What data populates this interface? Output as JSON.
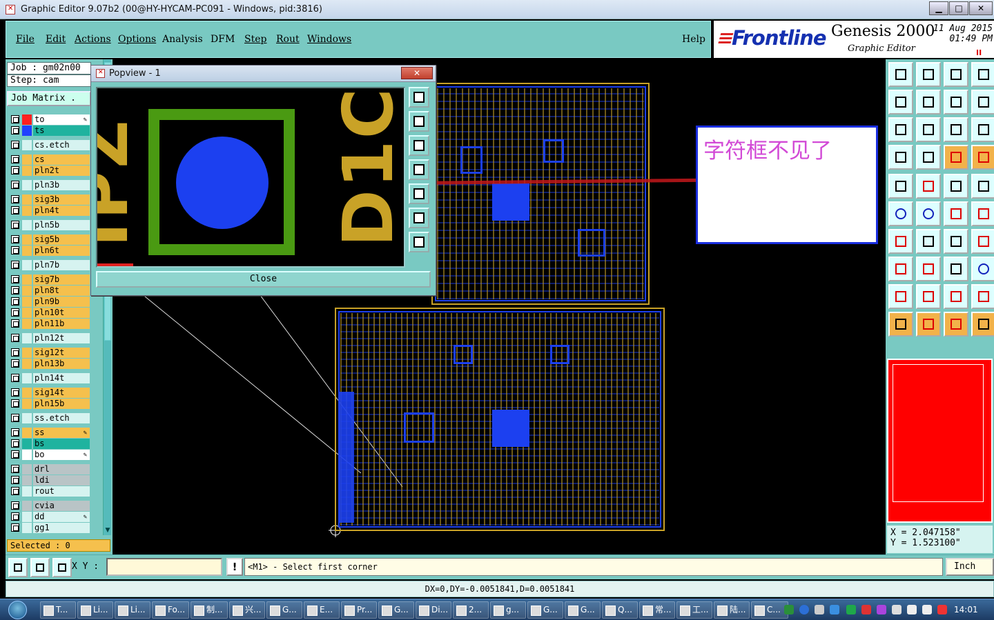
{
  "window": {
    "title": "Graphic Editor 9.07b2 (00@HY-HYCAM-PC091 - Windows, pid:3816)",
    "controls": [
      "▁",
      "□",
      "✕"
    ]
  },
  "menu": {
    "items": [
      "File",
      "Edit",
      "Actions",
      "Options",
      "Analysis",
      "DFM",
      "Step",
      "Rout",
      "Windows"
    ],
    "help": "Help"
  },
  "logo": {
    "brand": "Frontline",
    "product": "Genesis 2000",
    "subtitle": "Graphic Editor",
    "date": "11 Aug 2015",
    "time": "01:49 PM",
    "indicator": "II"
  },
  "job": {
    "job_line": "Job : gm02n00",
    "step_line": "Step: cam",
    "matrix_label": "Job Matrix ."
  },
  "layers": [
    {
      "name": "to",
      "color": "#ffffff",
      "swatch": "#ff2020",
      "pen": true
    },
    {
      "name": "ts",
      "color": "#1fb39f",
      "swatch": "#2040ff",
      "pen": false
    },
    {
      "name": "cs.etch",
      "color": "#d6f3f0",
      "swatch": "",
      "pen": false
    },
    {
      "name": "cs",
      "color": "#f5c04d",
      "swatch": "",
      "pen": false
    },
    {
      "name": "pln2t",
      "color": "#f5c04d",
      "swatch": "",
      "pen": false
    },
    {
      "name": "pln3b",
      "color": "#d6f3f0",
      "swatch": "",
      "pen": false
    },
    {
      "name": "sig3b",
      "color": "#f5c04d",
      "swatch": "",
      "pen": false
    },
    {
      "name": "pln4t",
      "color": "#f5c04d",
      "swatch": "",
      "pen": false
    },
    {
      "name": "pln5b",
      "color": "#d6f3f0",
      "swatch": "",
      "pen": false
    },
    {
      "name": "sig5b",
      "color": "#f5c04d",
      "swatch": "",
      "pen": false
    },
    {
      "name": "pln6t",
      "color": "#f5c04d",
      "swatch": "",
      "pen": false
    },
    {
      "name": "pln7b",
      "color": "#d6f3f0",
      "swatch": "",
      "pen": false
    },
    {
      "name": "sig7b",
      "color": "#f5c04d",
      "swatch": "",
      "pen": false
    },
    {
      "name": "pln8t",
      "color": "#f5c04d",
      "swatch": "",
      "pen": false
    },
    {
      "name": "pln9b",
      "color": "#f5c04d",
      "swatch": "",
      "pen": false
    },
    {
      "name": "pln10t",
      "color": "#f5c04d",
      "swatch": "",
      "pen": false
    },
    {
      "name": "pln11b",
      "color": "#f5c04d",
      "swatch": "",
      "pen": false
    },
    {
      "name": "pln12t",
      "color": "#d6f3f0",
      "swatch": "",
      "pen": false
    },
    {
      "name": "sig12t",
      "color": "#f5c04d",
      "swatch": "",
      "pen": false
    },
    {
      "name": "pln13b",
      "color": "#f5c04d",
      "swatch": "",
      "pen": false
    },
    {
      "name": "pln14t",
      "color": "#d6f3f0",
      "swatch": "",
      "pen": false
    },
    {
      "name": "sig14t",
      "color": "#f5c04d",
      "swatch": "",
      "pen": false
    },
    {
      "name": "pln15b",
      "color": "#f5c04d",
      "swatch": "",
      "pen": false
    },
    {
      "name": "ss.etch",
      "color": "#d6f3f0",
      "swatch": "",
      "pen": false
    },
    {
      "name": "ss",
      "color": "#f5c04d",
      "swatch": "",
      "pen": true
    },
    {
      "name": "bs",
      "color": "#1fb39f",
      "swatch": "",
      "pen": false
    },
    {
      "name": "bo",
      "color": "#ffffff",
      "swatch": "",
      "pen": true
    },
    {
      "name": "drl",
      "color": "#b9c4c6",
      "swatch": "",
      "pen": false
    },
    {
      "name": "ldi",
      "color": "#b9c4c6",
      "swatch": "",
      "pen": false
    },
    {
      "name": "rout",
      "color": "#d6f3f0",
      "swatch": "",
      "pen": false
    },
    {
      "name": "cvia",
      "color": "#b9c4c6",
      "swatch": "",
      "pen": false
    },
    {
      "name": "dd",
      "color": "#d6f3f0",
      "swatch": "",
      "pen": true
    },
    {
      "name": "gg1",
      "color": "#d6f3f0",
      "swatch": "",
      "pen": false
    }
  ],
  "selected": "Selected : 0",
  "annotation": {
    "text": "字符框不见了"
  },
  "popview": {
    "title": "Popview - 1",
    "close_x": "✕",
    "close_button": "Close",
    "view_text_left": "IPZ",
    "view_text_right": "D1C"
  },
  "command_bar": {
    "xy_label": "X Y :",
    "xy_value": "",
    "bang": "!",
    "prompt": "<M1> - Select first corner",
    "units": "Inch"
  },
  "coords": {
    "x": "X = 2.047158\"",
    "y": "Y = 1.523100\""
  },
  "status_line": "DX=0,DY=-0.0051841,D=0.0051841",
  "taskbar": {
    "items": [
      "T...",
      "Li...",
      "Li...",
      "Fo...",
      "制...",
      "兴...",
      "G...",
      "E...",
      "Pr...",
      "G...",
      "Di...",
      "2...",
      "g...",
      "G...",
      "G...",
      "Q...",
      "常...",
      "工...",
      "陆...",
      "C..."
    ],
    "clock": "14:01"
  }
}
